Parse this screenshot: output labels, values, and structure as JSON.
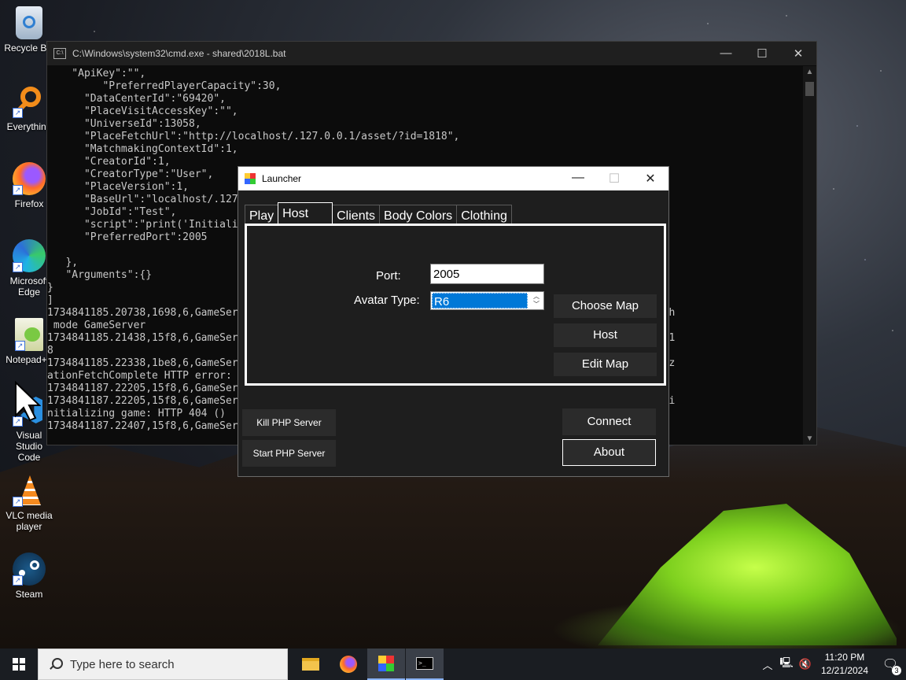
{
  "desktop": {
    "icons": [
      {
        "label": "Recycle Bin",
        "icon": "recycle-bin-icon"
      },
      {
        "label": "Everything",
        "icon": "everything-search-icon"
      },
      {
        "label": "Firefox",
        "icon": "firefox-icon"
      },
      {
        "label": "Microsoft Edge",
        "icon": "edge-icon"
      },
      {
        "label": "Notepad++",
        "icon": "notepadplusplus-icon"
      },
      {
        "label": "Visual Studio Code",
        "icon": "vscode-icon"
      },
      {
        "label": "VLC media player",
        "icon": "vlc-icon"
      },
      {
        "label": "Steam",
        "icon": "steam-icon"
      }
    ]
  },
  "cmd": {
    "title": "C:\\Windows\\system32\\cmd.exe - shared\\2018L.bat",
    "app_icon_text": "C:\\",
    "lines": [
      "    \"ApiKey\":\"\",",
      "         \"PreferredPlayerCapacity\":30,",
      "      \"DataCenterId\":\"69420\",",
      "      \"PlaceVisitAccessKey\":\"\",",
      "      \"UniverseId\":13058,",
      "      \"PlaceFetchUrl\":\"http://localhost/.127.0.0.1/asset/?id=1818\",",
      "      \"MatchmakingContextId\":1,",
      "      \"CreatorId\":1,",
      "      \"CreatorType\":\"User\",",
      "      \"PlaceVersion\":1,",
      "      \"BaseUrl\":\"localhost/.127.0.0.1\",",
      "      \"JobId\":\"Test\",",
      "      \"script\":\"print('Initializing')\",",
      "      \"PreferredPort\":2005",
      "",
      "   },",
      "   \"Arguments\":{}",
      "}",
      "]",
      "1734841185.20738,1698,6,GameServer                                              est Executing job with",
      " mode GameServer",
      "1734841185.21438,15f8,6,GameServer                                              est Fetching place 181",
      "8",
      "1734841185.22338,1be8,6,GameServer                                              est Error: autoLocaliz",
      "ationFetchComplete HTTP error:",
      "1734841187.22205,15f8,6,GameServer                                              est ***",
      "1734841187.22205,15f8,6,GameServer                                              est Failed to finish i",
      "nitializing game: HTTP 404 ()",
      "1734841187.22407,15f8,6,GameServer                                              est ***"
    ]
  },
  "launcher": {
    "title": "Launcher",
    "tabs": [
      {
        "label": "Play",
        "active": false
      },
      {
        "label": "Host",
        "active": true
      },
      {
        "label": "Clients",
        "active": false
      },
      {
        "label": "Body Colors",
        "active": false
      },
      {
        "label": "Clothing",
        "active": false
      }
    ],
    "port_label": "Port:",
    "port_value": "2005",
    "avatar_label": "Avatar Type:",
    "avatar_value": "R6",
    "choose_map": "Choose Map",
    "host": "Host",
    "edit_map": "Edit Map",
    "kill_php": "Kill PHP Server",
    "start_php": "Start PHP Server",
    "connect": "Connect",
    "about": "About"
  },
  "taskbar": {
    "search_placeholder": "Type here to search",
    "apps": [
      {
        "name": "file-explorer",
        "icon": "folder-icon",
        "active": false
      },
      {
        "name": "firefox",
        "icon": "firefox-icon",
        "active": false
      },
      {
        "name": "launcher",
        "icon": "launcher-app-icon",
        "active": true
      },
      {
        "name": "cmd",
        "icon": "terminal-icon",
        "active": true
      }
    ],
    "time": "11:20 PM",
    "date": "12/21/2024",
    "notification_count": "3"
  },
  "colors": {
    "cmd_bg": "#0c0c0c",
    "launcher_bg": "#1e1e1e",
    "selection": "#0078d7",
    "taskbar": "#1a1d22"
  }
}
